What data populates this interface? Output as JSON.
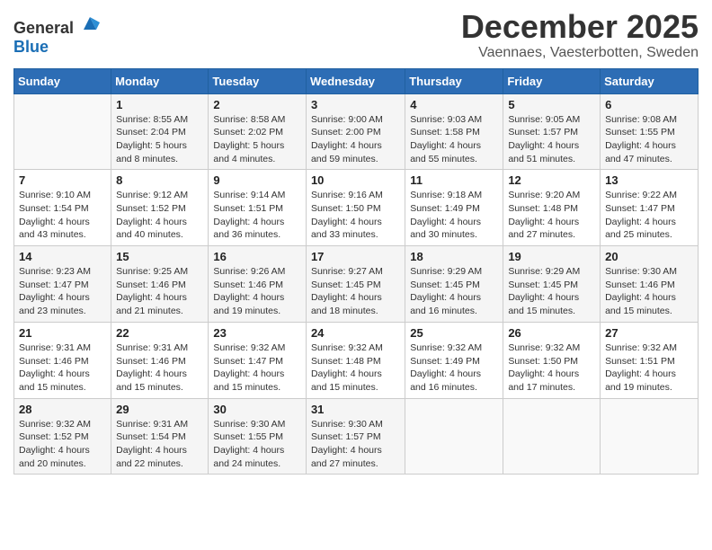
{
  "logo": {
    "text_general": "General",
    "text_blue": "Blue"
  },
  "title": {
    "month": "December 2025",
    "location": "Vaennaes, Vaesterbotten, Sweden"
  },
  "weekdays": [
    "Sunday",
    "Monday",
    "Tuesday",
    "Wednesday",
    "Thursday",
    "Friday",
    "Saturday"
  ],
  "weeks": [
    [
      {
        "day": "",
        "info": ""
      },
      {
        "day": "1",
        "info": "Sunrise: 8:55 AM\nSunset: 2:04 PM\nDaylight: 5 hours\nand 8 minutes."
      },
      {
        "day": "2",
        "info": "Sunrise: 8:58 AM\nSunset: 2:02 PM\nDaylight: 5 hours\nand 4 minutes."
      },
      {
        "day": "3",
        "info": "Sunrise: 9:00 AM\nSunset: 2:00 PM\nDaylight: 4 hours\nand 59 minutes."
      },
      {
        "day": "4",
        "info": "Sunrise: 9:03 AM\nSunset: 1:58 PM\nDaylight: 4 hours\nand 55 minutes."
      },
      {
        "day": "5",
        "info": "Sunrise: 9:05 AM\nSunset: 1:57 PM\nDaylight: 4 hours\nand 51 minutes."
      },
      {
        "day": "6",
        "info": "Sunrise: 9:08 AM\nSunset: 1:55 PM\nDaylight: 4 hours\nand 47 minutes."
      }
    ],
    [
      {
        "day": "7",
        "info": "Sunrise: 9:10 AM\nSunset: 1:54 PM\nDaylight: 4 hours\nand 43 minutes."
      },
      {
        "day": "8",
        "info": "Sunrise: 9:12 AM\nSunset: 1:52 PM\nDaylight: 4 hours\nand 40 minutes."
      },
      {
        "day": "9",
        "info": "Sunrise: 9:14 AM\nSunset: 1:51 PM\nDaylight: 4 hours\nand 36 minutes."
      },
      {
        "day": "10",
        "info": "Sunrise: 9:16 AM\nSunset: 1:50 PM\nDaylight: 4 hours\nand 33 minutes."
      },
      {
        "day": "11",
        "info": "Sunrise: 9:18 AM\nSunset: 1:49 PM\nDaylight: 4 hours\nand 30 minutes."
      },
      {
        "day": "12",
        "info": "Sunrise: 9:20 AM\nSunset: 1:48 PM\nDaylight: 4 hours\nand 27 minutes."
      },
      {
        "day": "13",
        "info": "Sunrise: 9:22 AM\nSunset: 1:47 PM\nDaylight: 4 hours\nand 25 minutes."
      }
    ],
    [
      {
        "day": "14",
        "info": "Sunrise: 9:23 AM\nSunset: 1:47 PM\nDaylight: 4 hours\nand 23 minutes."
      },
      {
        "day": "15",
        "info": "Sunrise: 9:25 AM\nSunset: 1:46 PM\nDaylight: 4 hours\nand 21 minutes."
      },
      {
        "day": "16",
        "info": "Sunrise: 9:26 AM\nSunset: 1:46 PM\nDaylight: 4 hours\nand 19 minutes."
      },
      {
        "day": "17",
        "info": "Sunrise: 9:27 AM\nSunset: 1:45 PM\nDaylight: 4 hours\nand 18 minutes."
      },
      {
        "day": "18",
        "info": "Sunrise: 9:29 AM\nSunset: 1:45 PM\nDaylight: 4 hours\nand 16 minutes."
      },
      {
        "day": "19",
        "info": "Sunrise: 9:29 AM\nSunset: 1:45 PM\nDaylight: 4 hours\nand 15 minutes."
      },
      {
        "day": "20",
        "info": "Sunrise: 9:30 AM\nSunset: 1:46 PM\nDaylight: 4 hours\nand 15 minutes."
      }
    ],
    [
      {
        "day": "21",
        "info": "Sunrise: 9:31 AM\nSunset: 1:46 PM\nDaylight: 4 hours\nand 15 minutes."
      },
      {
        "day": "22",
        "info": "Sunrise: 9:31 AM\nSunset: 1:46 PM\nDaylight: 4 hours\nand 15 minutes."
      },
      {
        "day": "23",
        "info": "Sunrise: 9:32 AM\nSunset: 1:47 PM\nDaylight: 4 hours\nand 15 minutes."
      },
      {
        "day": "24",
        "info": "Sunrise: 9:32 AM\nSunset: 1:48 PM\nDaylight: 4 hours\nand 15 minutes."
      },
      {
        "day": "25",
        "info": "Sunrise: 9:32 AM\nSunset: 1:49 PM\nDaylight: 4 hours\nand 16 minutes."
      },
      {
        "day": "26",
        "info": "Sunrise: 9:32 AM\nSunset: 1:50 PM\nDaylight: 4 hours\nand 17 minutes."
      },
      {
        "day": "27",
        "info": "Sunrise: 9:32 AM\nSunset: 1:51 PM\nDaylight: 4 hours\nand 19 minutes."
      }
    ],
    [
      {
        "day": "28",
        "info": "Sunrise: 9:32 AM\nSunset: 1:52 PM\nDaylight: 4 hours\nand 20 minutes."
      },
      {
        "day": "29",
        "info": "Sunrise: 9:31 AM\nSunset: 1:54 PM\nDaylight: 4 hours\nand 22 minutes."
      },
      {
        "day": "30",
        "info": "Sunrise: 9:30 AM\nSunset: 1:55 PM\nDaylight: 4 hours\nand 24 minutes."
      },
      {
        "day": "31",
        "info": "Sunrise: 9:30 AM\nSunset: 1:57 PM\nDaylight: 4 hours\nand 27 minutes."
      },
      {
        "day": "",
        "info": ""
      },
      {
        "day": "",
        "info": ""
      },
      {
        "day": "",
        "info": ""
      }
    ]
  ]
}
